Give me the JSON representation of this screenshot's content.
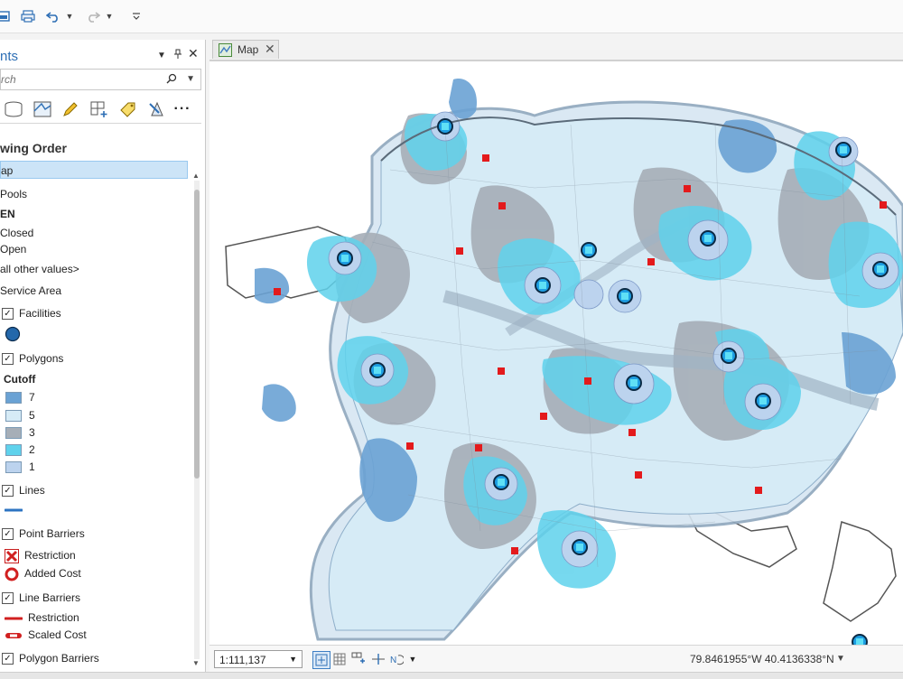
{
  "colors": {
    "accent": "#2e6fb5",
    "cutoff_7": "#6aa2d4",
    "cutoff_5": "#d6ebf6",
    "cutoff_3": "#a6aeb7",
    "cutoff_2": "#5fd2ec",
    "cutoff_1": "#bcd3ee",
    "facility": "#1e9ee2",
    "barrier": "#e31a1c"
  },
  "quick_access": {
    "icons": [
      "save-icon",
      "print-icon",
      "undo-icon",
      "redo-icon",
      "customize-icon"
    ]
  },
  "contents": {
    "title": "nts",
    "search_placeholder": "rch",
    "drawing_order": "wing Order",
    "items": {
      "map": "ap",
      "pools": "Pools",
      "open_group": "EN",
      "closed": "Closed",
      "open": "Open",
      "other": "all other values>",
      "service_area": "Service Area",
      "facilities": "Facilities",
      "polygons": "Polygons",
      "cutoff": "Cutoff",
      "c7": "7",
      "c5": "5",
      "c3": "3",
      "c2": "2",
      "c1": "1",
      "lines": "Lines",
      "point_barriers": "Point Barriers",
      "restriction": "Restriction",
      "added_cost": "Added Cost",
      "line_barriers": "Line Barriers",
      "line_restriction": "Restriction",
      "scaled_cost": "Scaled Cost",
      "polygon_barriers": "Polygon Barriers"
    }
  },
  "map_tab": {
    "label": "Map"
  },
  "status": {
    "scale": "1:111,137",
    "coords": "79.8461955°W 40.4136338°N"
  }
}
